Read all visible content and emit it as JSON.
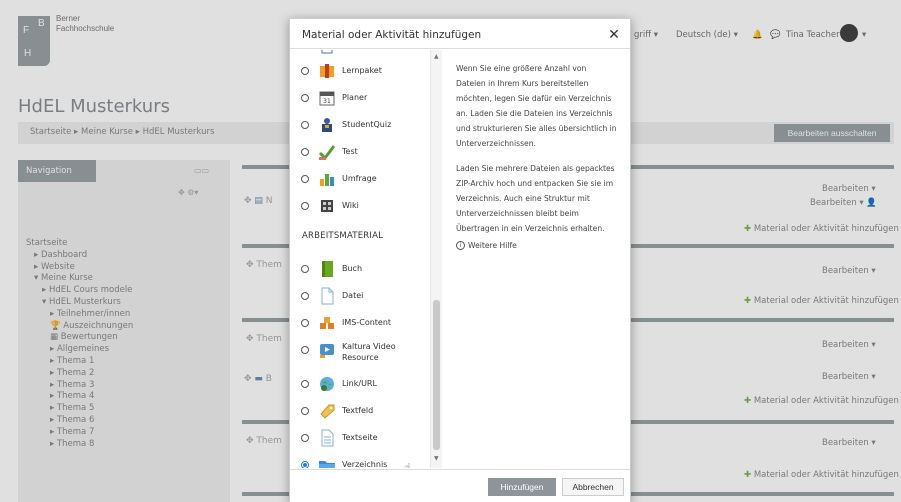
{
  "brand": {
    "logo_letters": [
      "F",
      "B",
      "H"
    ],
    "line1": "Berner",
    "line2": "Fachhochschule"
  },
  "header": {
    "access_menu": "griff ▾",
    "language": "Deutsch (de) ▾",
    "user_name": "Tina Teacher"
  },
  "course": {
    "title": "HdEL Musterkurs",
    "breadcrumb": "Startseite ▸ Meine Kurse ▸ HdEL Musterkurs",
    "edit_off_label": "Bearbeiten ausschalten"
  },
  "navigation": {
    "title": "Navigation",
    "items": [
      {
        "label": "Startseite",
        "level": 0
      },
      {
        "label": "▸ Dashboard",
        "level": 1
      },
      {
        "label": "▸ Website",
        "level": 1
      },
      {
        "label": "▾ Meine Kurse",
        "level": 1
      },
      {
        "label": "▸ HdEL Cours modele",
        "level": 2
      },
      {
        "label": "▾ HdEL Musterkurs",
        "level": 2
      },
      {
        "label": "▸ Teilnehmer/innen",
        "level": 3
      },
      {
        "label": "🏆 Auszeichnungen",
        "level": 3
      },
      {
        "label": "▦ Bewertungen",
        "level": 3
      },
      {
        "label": "▸ Allgemeines",
        "level": 3
      },
      {
        "label": "▸ Thema 1",
        "level": 3
      },
      {
        "label": "▸ Thema 2",
        "level": 3
      },
      {
        "label": "▸ Thema 3",
        "level": 3
      },
      {
        "label": "▸ Thema 4",
        "level": 3
      },
      {
        "label": "▸ Thema 5",
        "level": 3
      },
      {
        "label": "▸ Thema 6",
        "level": 3
      },
      {
        "label": "▸ Thema 7",
        "level": 3
      },
      {
        "label": "▸ Thema 8",
        "level": 3
      }
    ]
  },
  "sections": {
    "edit_label": "Bearbeiten ▾",
    "add_activity_label": "Material oder Aktivität hinzufügen",
    "topic_prefix": "Them",
    "n_prefix": "N",
    "b_prefix": "B"
  },
  "modal": {
    "title": "Material oder Aktivität hinzufügen",
    "close_glyph": "✕",
    "activities": [
      {
        "label": "Lernpaket",
        "icon": "package-icon"
      },
      {
        "label": "Planer",
        "icon": "calendar-icon"
      },
      {
        "label": "StudentQuiz",
        "icon": "student-quiz-icon"
      },
      {
        "label": "Test",
        "icon": "checkmark-icon"
      },
      {
        "label": "Umfrage",
        "icon": "bar-chart-icon"
      },
      {
        "label": "Wiki",
        "icon": "wiki-icon"
      }
    ],
    "resources_heading": "ARBEITSMATERIAL",
    "resources": [
      {
        "label": "Buch",
        "icon": "book-icon"
      },
      {
        "label": "Datei",
        "icon": "file-icon"
      },
      {
        "label": "IMS-Content",
        "icon": "ims-package-icon"
      },
      {
        "label": "Kaltura Video Resource",
        "icon": "kaltura-video-icon"
      },
      {
        "label": "Link/URL",
        "icon": "globe-link-icon"
      },
      {
        "label": "Textfeld",
        "icon": "label-tag-icon"
      },
      {
        "label": "Textseite",
        "icon": "text-page-icon"
      },
      {
        "label": "Verzeichnis",
        "icon": "folder-icon",
        "selected": true
      }
    ],
    "help_paragraphs": [
      "Wenn Sie eine größere Anzahl von Dateien in Ihrem Kurs bereitstellen möchten, legen Sie dafür ein Verzeichnis an. Laden Sie die Dateien ins Verzeichnis und strukturieren Sie alles übersichtlich in Unterverzeichnissen.",
      "Laden Sie mehrere Dateien als gepacktes ZIP-Archiv hoch und entpacken Sie sie im Verzeichnis. Auch eine Struktur mit Unterverzeichnissen bleibt beim Übertragen in ein Verzeichnis erhalten."
    ],
    "more_help": "Weitere Hilfe",
    "add_button": "Hinzufügen",
    "cancel_button": "Abbrechen"
  },
  "colors": {
    "accent_gray": "#9aa3a8",
    "radio_selected": "#2a7de1",
    "add_green": "#7bb342"
  }
}
